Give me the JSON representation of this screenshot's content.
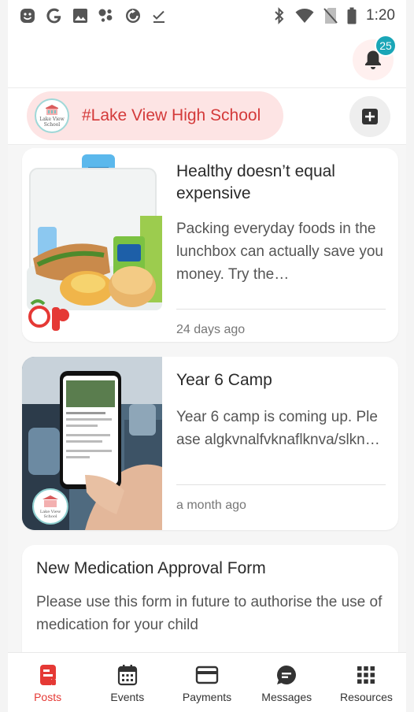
{
  "status_bar": {
    "time": "1:20",
    "left_icons": [
      "smile-icon",
      "google-icon",
      "gallery-icon",
      "assistant-icon",
      "refresh-icon",
      "check-icon"
    ],
    "right_icons": [
      "bluetooth-icon",
      "wifi-icon",
      "no-sim-icon",
      "battery-icon"
    ]
  },
  "header": {
    "notification_count": "25"
  },
  "school": {
    "name": "#Lake View High School",
    "logo_text": "Lake View School"
  },
  "feed": {
    "items": [
      {
        "title": "Healthy doesn’t equal expensive",
        "excerpt": "Packing everyday foods in the lunchbox can actually save you money.   Try the…",
        "time": "24 days ago"
      },
      {
        "title": "Year 6 Camp",
        "excerpt": "Year 6 camp is coming up.    Please algkvnalfvknaflknva/slkn…",
        "time": "a month ago",
        "thumb_logo_text": "Lake View School"
      },
      {
        "title": "New Medication Approval Form",
        "excerpt": "Please use this form in future to authorise the use of medication for your child"
      }
    ]
  },
  "bottom_nav": {
    "items": [
      {
        "label": "Posts",
        "icon": "posts-icon",
        "active": true
      },
      {
        "label": "Events",
        "icon": "calendar-icon",
        "active": false
      },
      {
        "label": "Payments",
        "icon": "card-icon",
        "active": false
      },
      {
        "label": "Messages",
        "icon": "chat-icon",
        "active": false
      },
      {
        "label": "Resources",
        "icon": "grid-icon",
        "active": false
      }
    ]
  },
  "colors": {
    "accent": "#e53935",
    "chip_bg": "#fde4e4",
    "badge": "#1aa6b7"
  }
}
